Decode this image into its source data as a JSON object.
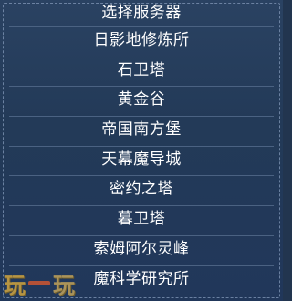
{
  "header": {
    "title": "选择服务器"
  },
  "servers": [
    "日影地修炼所",
    "石卫塔",
    "黄金谷",
    "帝国南方堡",
    "天幕魔导城",
    "密约之塔",
    "暮卫塔",
    "索姆阿尔灵峰",
    "魔科学研究所"
  ],
  "watermark": {
    "left": "玩",
    "right": "玩"
  }
}
